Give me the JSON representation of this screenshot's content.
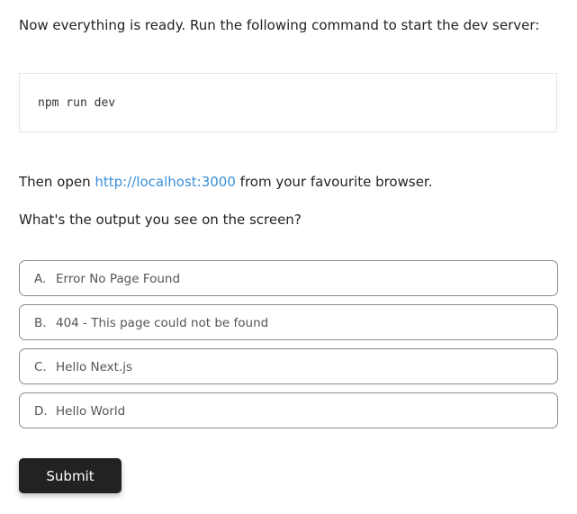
{
  "intro": "Now everything is ready. Run the following command to start the dev server:",
  "code": "npm run dev",
  "open_line": {
    "before": "Then open ",
    "link_text": "http://localhost:3000",
    "after": " from your favourite browser."
  },
  "question": "What's the output you see on the screen?",
  "options": [
    {
      "letter": "A.",
      "label": "Error No Page Found"
    },
    {
      "letter": "B.",
      "label": "404 - This page could not be found"
    },
    {
      "letter": "C.",
      "label": "Hello Next.js"
    },
    {
      "letter": "D.",
      "label": "Hello World"
    }
  ],
  "submit_label": "Submit",
  "colors": {
    "link": "#3a8fd9",
    "button_bg": "#222222",
    "option_border": "#8a8a8a"
  }
}
